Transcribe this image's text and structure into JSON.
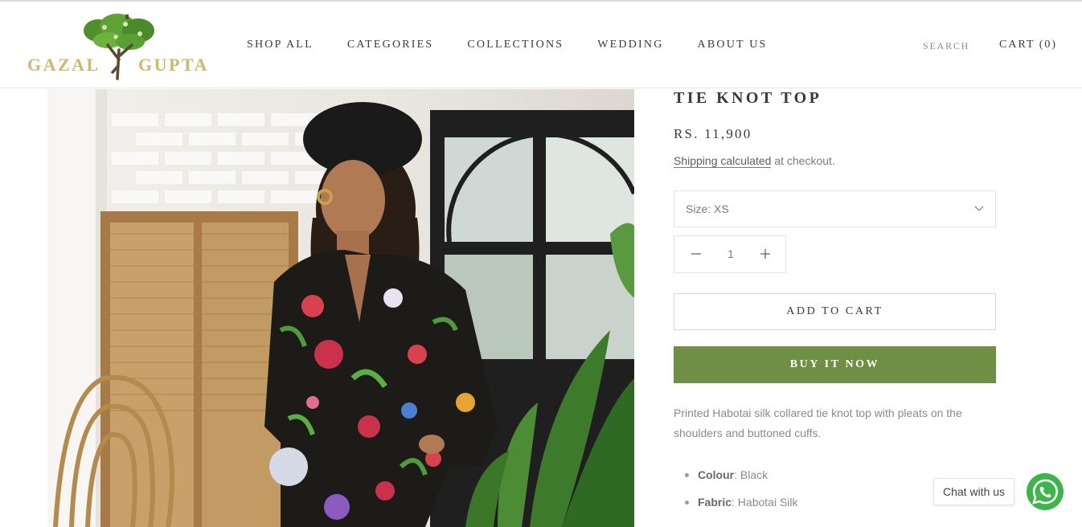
{
  "header": {
    "logo": {
      "left": "GAZAL",
      "right": "GUPTA"
    },
    "nav": [
      {
        "label": "SHOP ALL"
      },
      {
        "label": "CATEGORIES"
      },
      {
        "label": "COLLECTIONS"
      },
      {
        "label": "WEDDING"
      },
      {
        "label": "ABOUT US"
      }
    ],
    "search_label": "SEARCH",
    "cart_label": "CART (0)"
  },
  "product": {
    "title": "TIE KNOT TOP",
    "price": "RS. 11,900",
    "shipping_link": "Shipping calculated",
    "shipping_rest": " at checkout.",
    "size_selected": "Size: XS",
    "quantity": "1",
    "add_to_cart": "ADD TO CART",
    "buy_now": "BUY IT NOW",
    "description": "Printed Habotai silk collared tie knot top with pleats on the shoulders and buttoned cuffs.",
    "specs": [
      {
        "label": "Colour",
        "value": ": Black"
      },
      {
        "label": "Fabric",
        "value": ":  Habotai Silk"
      }
    ]
  },
  "chat": {
    "label": "Chat with us"
  },
  "colors": {
    "accent": "#6f8f45",
    "logo_gold": "#d4b56a",
    "text": "#3a3a3a"
  },
  "icons": [
    "tree-logo-icon",
    "chevron-down-icon",
    "minus-icon",
    "plus-icon",
    "whatsapp-icon"
  ]
}
